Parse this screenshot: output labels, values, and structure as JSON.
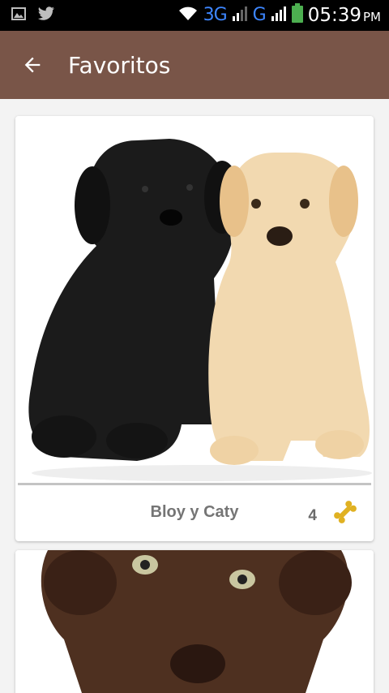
{
  "status_bar": {
    "icons": [
      "image-icon",
      "twitter-icon",
      "wifi-icon",
      "signal-icon",
      "battery-icon"
    ],
    "network_1": "3G",
    "network_2": "G",
    "time": "05:39",
    "ampm": "PM"
  },
  "app_bar": {
    "back_icon": "arrow-left-icon",
    "title": "Favoritos",
    "color": "#795548"
  },
  "cards": [
    {
      "name": "Bloy y Caty",
      "rating": "4",
      "rating_icon": "bone-icon"
    },
    {
      "name": "",
      "rating": "",
      "rating_icon": ""
    }
  ],
  "colors": {
    "accent": "#795548",
    "bone": "#e0b122"
  }
}
